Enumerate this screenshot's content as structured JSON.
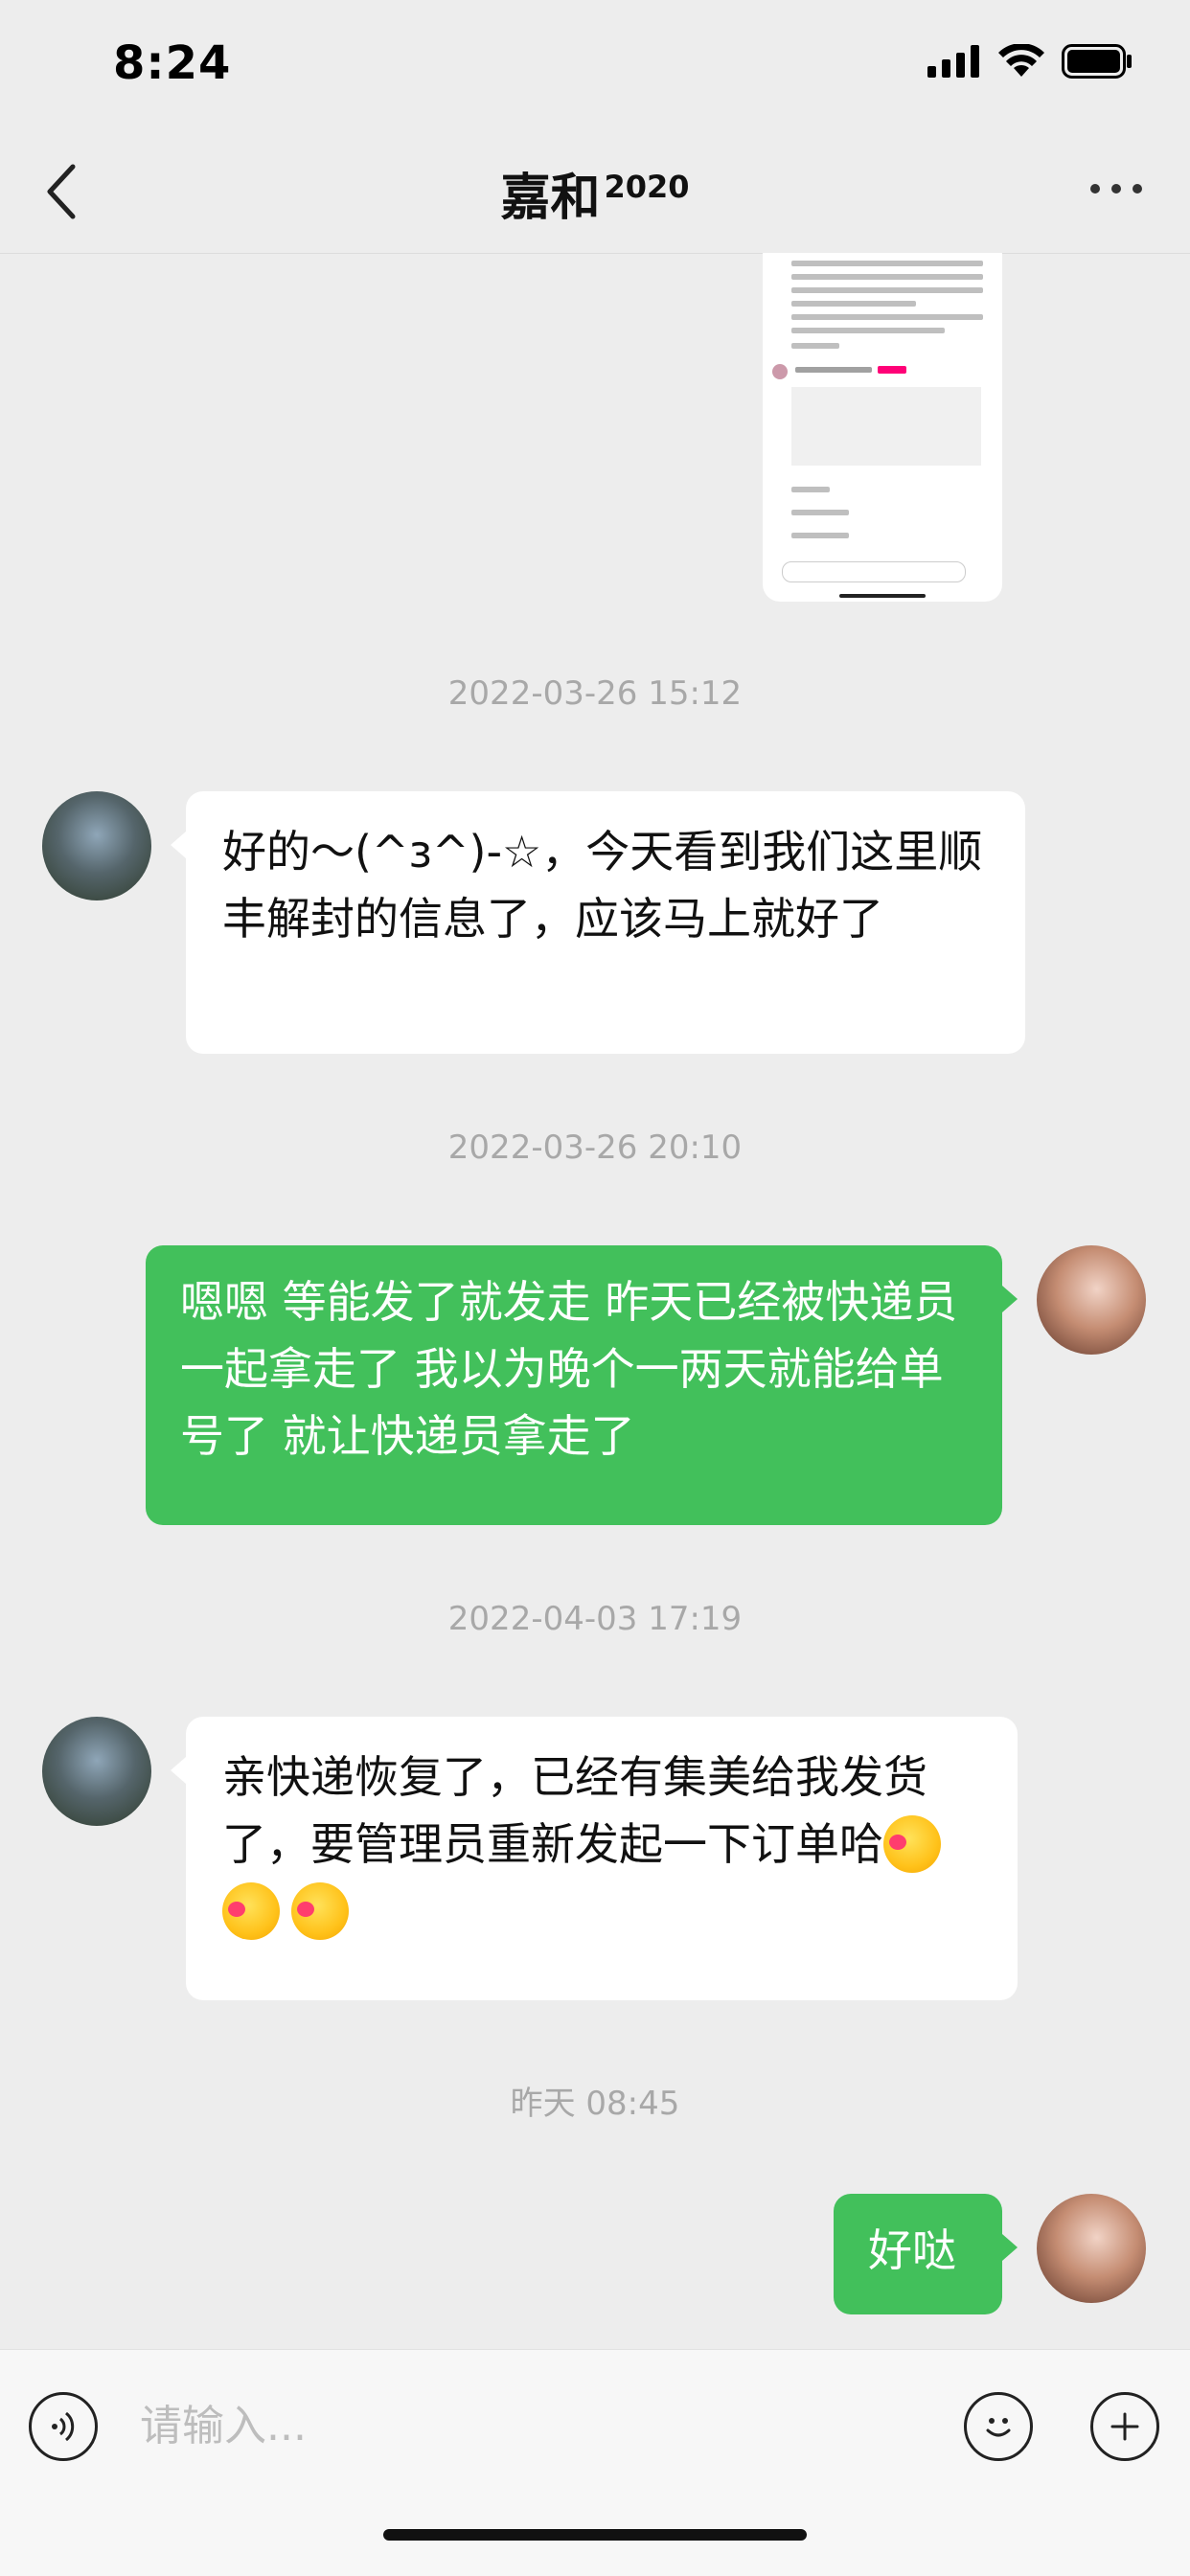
{
  "status_bar": {
    "time": "8:24"
  },
  "nav": {
    "title": "嘉和",
    "title_sup": "2020"
  },
  "messages": [
    {
      "timestamp": "2022-03-26 15:12",
      "side": "in",
      "text": "好的～(^з^)-☆，今天看到我们这里顺丰解封的信息了，应该马上就好了"
    },
    {
      "timestamp": "2022-03-26 20:10",
      "side": "out",
      "text": "嗯嗯  等能发了就发走 昨天已经被快递员一起拿走了 我以为晚个一两天就能给单号了 就让快递员拿走了"
    },
    {
      "timestamp": "2022-04-03 17:19",
      "side": "in",
      "text": " 亲快递恢复了，已经有集美给我发货了，要管理员重新发起一下订单哈"
    },
    {
      "timestamp": "昨天 08:45",
      "side": "out",
      "text": "好哒"
    }
  ],
  "input": {
    "placeholder": "请输入..."
  },
  "icons": {
    "back": "back-chevron-icon",
    "more": "more-dots-icon",
    "voice": "voice-icon",
    "emoji": "emoji-icon",
    "plus": "plus-icon"
  },
  "colors": {
    "bubble_out": "#42c05b",
    "bubble_in": "#ffffff",
    "background": "#ededed"
  }
}
